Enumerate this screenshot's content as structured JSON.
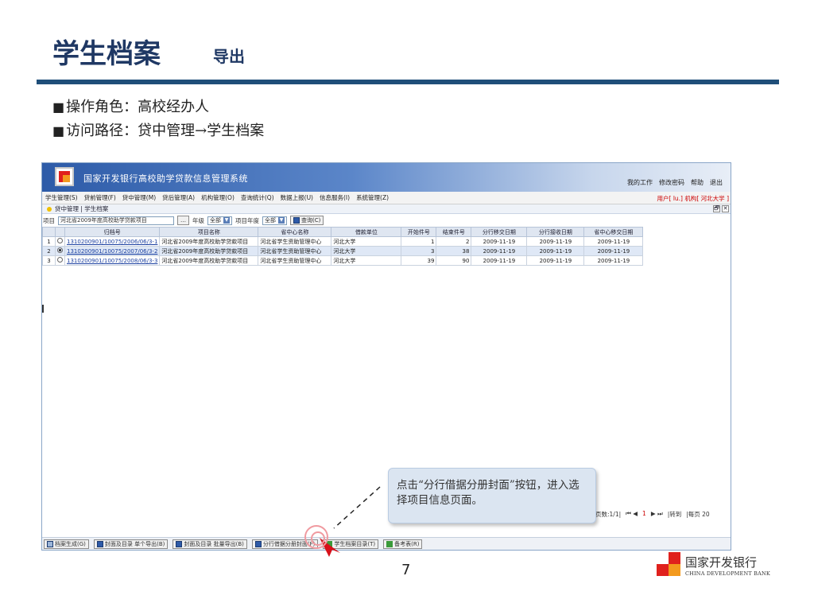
{
  "slide": {
    "title": "学生档案",
    "subtitle": "导出",
    "bullets": [
      {
        "marker": "■",
        "text": "操作角色：高校经办人"
      },
      {
        "marker": "■",
        "text": "访问路径：贷中管理→学生档案"
      }
    ],
    "page_number": "7",
    "callout": "点击“分行借据分册封面”按钮，进入选择项目信息页面。",
    "bank": {
      "name_cn": "国家开发银行",
      "name_en": "CHINA DEVELOPMENT BANK"
    }
  },
  "app": {
    "title": "国家开发银行高校助学贷款信息管理系统",
    "header_links": [
      "我的工作",
      "修改密码",
      "帮助",
      "退出"
    ],
    "menu": [
      "学生管理(S)",
      "贷前管理(F)",
      "贷中管理(M)",
      "贷后管理(A)",
      "机构管理(O)",
      "查询统计(Q)",
      "数据上报(U)",
      "信息服务(I)",
      "系统管理(Z)"
    ],
    "user_info": "用户[ lu.] 机构[ 河北大学 ]",
    "breadcrumb": "贷中管理 | 学生档案",
    "window_buttons": [
      "🗗",
      "✕"
    ],
    "filters": {
      "project_label": "项目",
      "project_value": "河北省2009年度高校助学贷款项目",
      "ellipsis": "…",
      "grade_label": "年级",
      "grade_value": "全部",
      "year_label": "项目年度",
      "year_value": "全部",
      "query_button": "查询(C)"
    },
    "table": {
      "headers": [
        "",
        "",
        "归档号",
        "项目名称",
        "省中心名称",
        "借款单位",
        "开始件号",
        "结束件号",
        "分行移交日期",
        "分行接收日期",
        "省中心移交日期"
      ],
      "rows": [
        {
          "idx": "1",
          "archive": "1310200901/10075/2006/06/3-1",
          "project": "河北省2009年度高校助学贷款项目",
          "center": "河北省学生资助管理中心",
          "unit": "河北大学",
          "start": "1",
          "end": "2",
          "d1": "2009-11-19",
          "d2": "2009-11-19",
          "d3": "2009-11-19",
          "selected": false
        },
        {
          "idx": "2",
          "archive": "1310200901/10075/2007/06/3-2",
          "project": "河北省2009年度高校助学贷款项目",
          "center": "河北省学生资助管理中心",
          "unit": "河北大学",
          "start": "3",
          "end": "38",
          "d1": "2009-11-19",
          "d2": "2009-11-19",
          "d3": "2009-11-19",
          "selected": true
        },
        {
          "idx": "3",
          "archive": "1310200901/10075/2008/06/3-3",
          "project": "河北省2009年度高校助学贷款项目",
          "center": "河北省学生资助管理中心",
          "unit": "河北大学",
          "start": "39",
          "end": "90",
          "d1": "2009-11-19",
          "d2": "2009-11-19",
          "d3": "2009-11-19",
          "selected": false
        }
      ]
    },
    "pager": {
      "pages": "页数:1/1|",
      "first_prev": "⏮ ◀",
      "current": "1",
      "next_last": "▶ ⏭",
      "goto": "|转到",
      "per_page": "|每页 20"
    },
    "bottom_buttons": [
      "档案生成(G)",
      "封面及目录 单个导出(B)",
      "封面及目录 批量导出(B)",
      "分行借据分册封面(F)",
      "学生档案目录(T)",
      "备考表(R)"
    ]
  }
}
